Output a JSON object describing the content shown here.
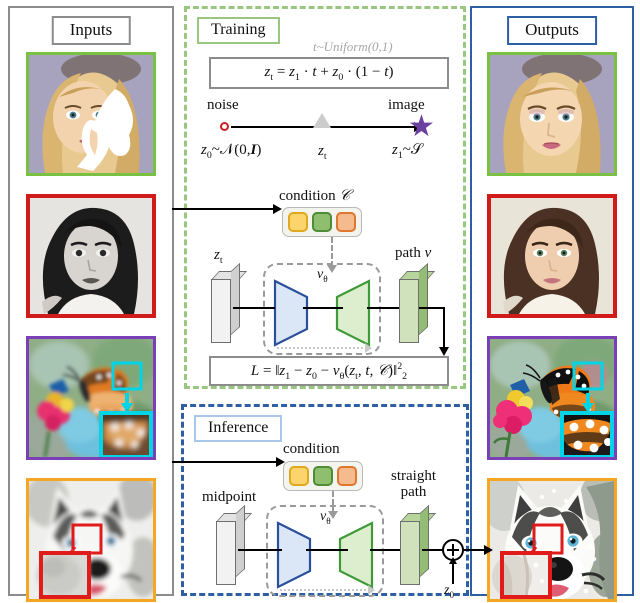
{
  "columns": {
    "inputs": {
      "title": "Inputs",
      "border_color": "#8c8c8c",
      "items": [
        {
          "name": "degraded-face-inpainting",
          "border_color": "#7ac143",
          "caption": "blonde woman portrait with white mask occlusion"
        },
        {
          "name": "grayscale-portrait",
          "border_color": "#d11a1a",
          "caption": "black and white portrait of young woman"
        },
        {
          "name": "blurry-butterfly",
          "border_color": "#7b3fb8",
          "caption": "blurred monarch butterfly on pink flower with cyan zoom insets"
        },
        {
          "name": "blurry-husky",
          "border_color": "#f5a623",
          "caption": "blurred husky dog in snow with red zoom insets"
        }
      ]
    },
    "outputs": {
      "title": "Outputs",
      "border_color": "#2e5fa3",
      "items": [
        {
          "name": "restored-face",
          "border_color": "#7ac143",
          "caption": "restored blonde woman portrait"
        },
        {
          "name": "colorized-portrait",
          "border_color": "#d11a1a",
          "caption": "colorized portrait of young woman"
        },
        {
          "name": "sharp-butterfly",
          "border_color": "#7b3fb8",
          "caption": "sharp monarch butterfly on pink flower with cyan zoom insets"
        },
        {
          "name": "sharp-husky",
          "border_color": "#f5a623",
          "caption": "sharp husky dog in snow with red zoom insets"
        }
      ]
    }
  },
  "training": {
    "title": "Training",
    "border_color": "#9ac77f",
    "t_distribution": "t~Uniform(0,1)",
    "interpolation_formula": "z_t = z_1 · t + z_0 · (1 − t)",
    "axis": {
      "left_label": "noise",
      "right_label": "image",
      "left_sub": "z_0 ~ N(0, I)",
      "mid_sub": "z_t",
      "right_sub": "z_1 ~ S",
      "marker_noise": "open-circle",
      "marker_mid": "triangle",
      "marker_image": "star",
      "noise_color": "#cc2222",
      "mid_color": "#cccccc",
      "star_color": "#6b3fa0"
    },
    "condition": {
      "label": "condition C",
      "chips": [
        {
          "name": "condition-chip-yellow",
          "color": "#fbd46b",
          "border": "#e0a81e"
        },
        {
          "name": "condition-chip-green",
          "color": "#8fbf6e",
          "border": "#4f8c36"
        },
        {
          "name": "condition-chip-orange",
          "color": "#f6ba8f",
          "border": "#e0772e"
        }
      ]
    },
    "network": {
      "input_label": "z_t",
      "model_label": "v_θ",
      "output_label": "path v",
      "encoder_color": "#dbe7f6",
      "encoder_border": "#2a4f9b",
      "decoder_color": "#ddeece",
      "decoder_border": "#3f9a38"
    },
    "loss_formula": "L = ||z_1 − z_0 − v_θ(z_t, t, C)||²_2"
  },
  "inference": {
    "title": "Inference",
    "border_color": "#2e5fa3",
    "title_border": "#a8c8ea",
    "condition": {
      "label": "condition",
      "chips": [
        {
          "name": "condition-chip-yellow",
          "color": "#fbd46b",
          "border": "#e0a81e"
        },
        {
          "name": "condition-chip-green",
          "color": "#8fbf6e",
          "border": "#4f8c36"
        },
        {
          "name": "condition-chip-orange",
          "color": "#f6ba8f",
          "border": "#e0772e"
        }
      ]
    },
    "network": {
      "input_label": "midpoint",
      "model_label": "v_θ",
      "output_label_line1": "straight",
      "output_label_line2": "path"
    },
    "sum_operator": "⊕",
    "sum_input_label": "z_0"
  }
}
